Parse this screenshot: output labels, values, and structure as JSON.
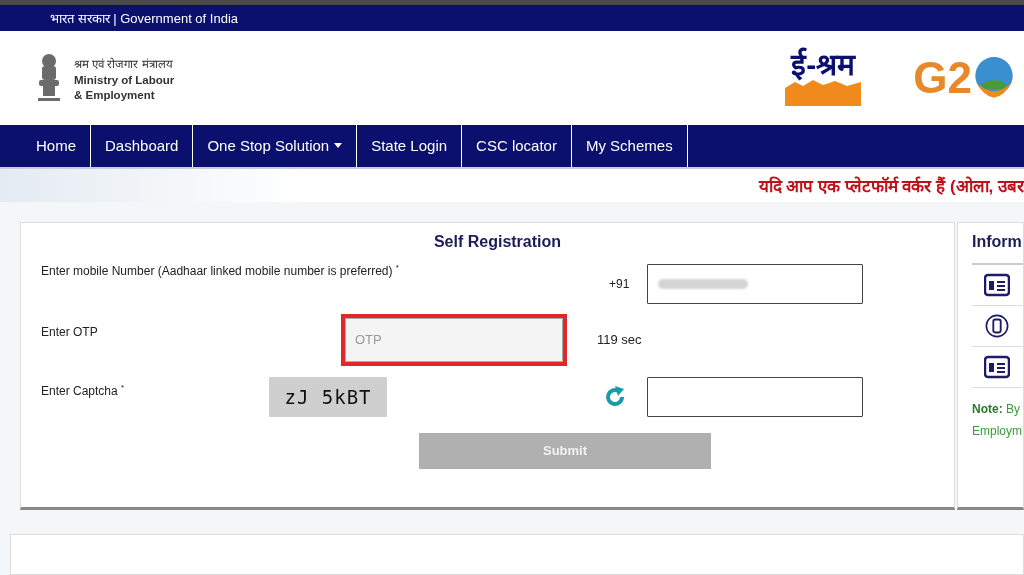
{
  "top_bar": {
    "text": "भारत सरकार | Government of India"
  },
  "header": {
    "ministry_hindi": "श्रम एवं रोजगार मंत्रालय",
    "ministry_lines": [
      "Ministry of Labour",
      "& Employment"
    ],
    "eshram_logo": "ई-श्रम",
    "g20_logo": "G2"
  },
  "nav": {
    "items": [
      {
        "label": "Home",
        "has_dropdown": false
      },
      {
        "label": "Dashboard",
        "has_dropdown": false
      },
      {
        "label": "One Stop Solution",
        "has_dropdown": true
      },
      {
        "label": "State Login",
        "has_dropdown": false
      },
      {
        "label": "CSC locator",
        "has_dropdown": false
      },
      {
        "label": "My Schemes",
        "has_dropdown": false
      }
    ]
  },
  "marquee": "यदि आप एक प्लेटफॉर्म वर्कर हैं (ओला, उबर",
  "form": {
    "title": "Self Registration",
    "mobile": {
      "label": "Enter mobile Number (Aadhaar linked mobile number is preferred)",
      "required_mark": "*",
      "prefix": "+91"
    },
    "otp": {
      "label": "Enter OTP",
      "placeholder": "OTP",
      "error": true,
      "timer": "119 sec"
    },
    "captcha": {
      "label": "Enter Captcha",
      "required_mark": "*",
      "image_text": "zJ 5kBT"
    },
    "submit": {
      "label": "Submit",
      "disabled": true
    }
  },
  "info": {
    "title": "Inform",
    "items": [
      {
        "kind": "card"
      },
      {
        "kind": "phone"
      },
      {
        "kind": "card"
      }
    ],
    "note": [
      "**Note:** By",
      "Employm"
    ]
  }
}
